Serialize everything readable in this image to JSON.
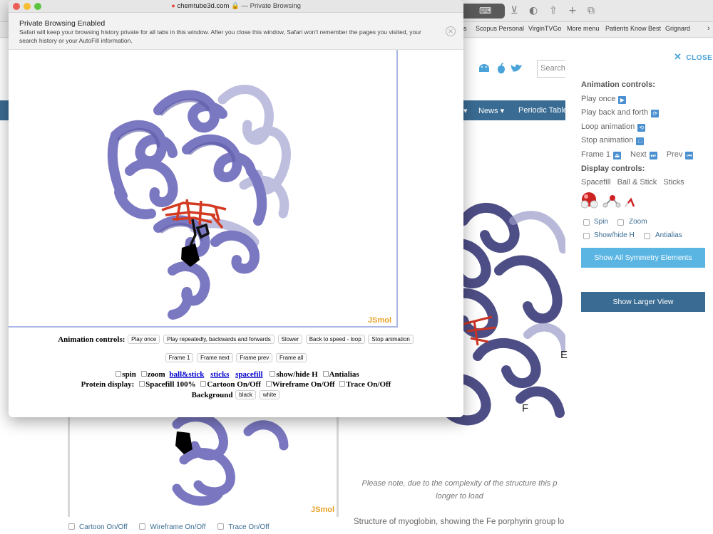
{
  "fg_window": {
    "host": "chemtube3d.com",
    "mode": "— Private Browsing",
    "banner_title": "Private Browsing Enabled",
    "banner_text": "Safari will keep your browsing history private for all tabs in this window. After you close this window, Safari won't remember the pages you visited, your search history or your AutoFill information.",
    "jsmol_label": "JSmol",
    "animation_label": "Animation controls:",
    "animation_buttons": [
      "Play once",
      "Play repeatedly, backwards and forwards",
      "Slower",
      "Back to speed - loop",
      "Stop animation"
    ],
    "frame_buttons": [
      "Frame 1",
      "Frame next",
      "Frame prev",
      "Frame all"
    ],
    "spin": "spin",
    "zoom": "zoom",
    "ball_stick": "ball&stick",
    "sticks": "sticks",
    "spacefill": "spacefill",
    "show_hide_h": "show/hide H",
    "antialias": "Antialias",
    "protein_label": "Protein display:",
    "spacefill_100": "Spacefill 100%",
    "cartoon": "Cartoon On/Off",
    "wireframe": "Wireframe On/Off",
    "trace": "Trace On/Off",
    "background_label": "Background",
    "bg_buttons": [
      "black",
      "white"
    ]
  },
  "bg_browser": {
    "bookmarks": [
      "s",
      "Scopus Personal",
      "VirginTVGo",
      "More menu",
      "Patients Know Best",
      "Grignard"
    ],
    "search_placeholder": "Search",
    "nav": [
      "News",
      "Periodic Table"
    ],
    "label_E": "E",
    "label_F": "F",
    "note": "Please note, due to the complexity of the structure this p longer to load",
    "caption": "Structure of myoglobin, showing the Fe porphyrin group lo helices E and F",
    "jsmol_small": "JSmol",
    "bottom_controls": [
      "Cartoon On/Off",
      "Wireframe On/Off",
      "Trace On/Off"
    ]
  },
  "panel": {
    "close": "CLOSE",
    "animation_heading": "Animation controls:",
    "play_once": "Play once",
    "play_back_forth": "Play back and forth",
    "loop": "Loop animation",
    "stop": "Stop animation",
    "frame1": "Frame 1",
    "next": "Next",
    "prev": "Prev",
    "display_heading": "Display controls:",
    "styles": [
      "Spacefill",
      "Ball & Stick",
      "Sticks"
    ],
    "spin": "Spin",
    "zoom": "Zoom",
    "show_hide_h": "Show/hide H",
    "antialias": "Antialias",
    "symmetry_button": "Show All Symmetry Elements",
    "larger_button": "Show Larger View"
  },
  "colors": {
    "protein": "#7a77c0",
    "heme": "#cc3322",
    "nav": "#3a6c93",
    "accent": "#5ab5e3",
    "jsmol": "#e8a329"
  }
}
